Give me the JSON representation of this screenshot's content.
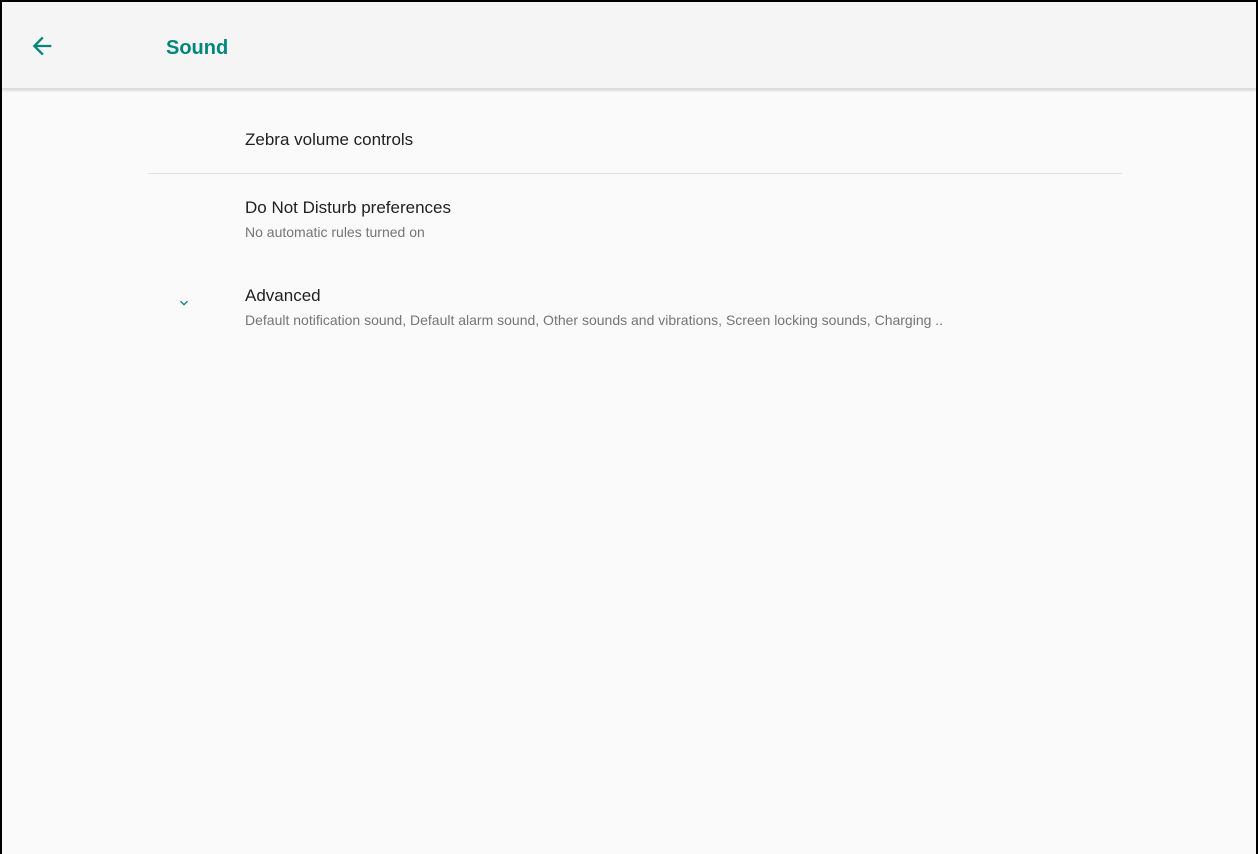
{
  "header": {
    "title": "Sound",
    "back_icon": "arrow-back-icon",
    "accent_color": "#00897b"
  },
  "items": [
    {
      "primary": "Zebra volume controls"
    },
    {
      "primary": "Do Not Disturb preferences",
      "secondary": "No automatic rules turned on"
    },
    {
      "icon": "chevron-down-icon",
      "primary": "Advanced",
      "secondary": "Default notification sound, Default alarm sound, Other sounds and vibrations, Screen locking sounds, Charging .."
    }
  ]
}
